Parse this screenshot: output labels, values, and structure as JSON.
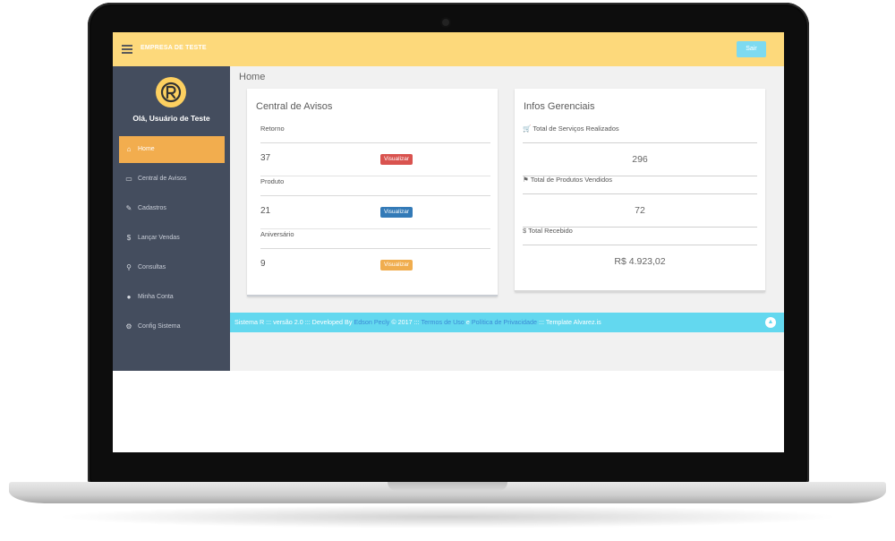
{
  "topbar": {
    "company_name": "EMPRESA DE TESTE",
    "logout_label": "Sair"
  },
  "sidebar": {
    "greeting": "Olá, Usuário de Teste",
    "items": [
      {
        "label": "Home",
        "icon": "home-icon"
      },
      {
        "label": "Central de Avisos",
        "icon": "monitor-icon"
      },
      {
        "label": "Cadastros",
        "icon": "edit-icon"
      },
      {
        "label": "Lançar Vendas",
        "icon": "dollar-icon"
      },
      {
        "label": "Consultas",
        "icon": "search-icon"
      },
      {
        "label": "Minha Conta",
        "icon": "user-icon"
      },
      {
        "label": "Config Sistema",
        "icon": "gears-icon"
      }
    ]
  },
  "main": {
    "page_title": "Home",
    "notices": {
      "title": "Central de Avisos",
      "rows": [
        {
          "label": "Retorno",
          "value": "37",
          "button": "Visualizar",
          "color": "#d9534f"
        },
        {
          "label": "Produto",
          "value": "21",
          "button": "Visualizar",
          "color": "#337ab7"
        },
        {
          "label": "Aniversário",
          "value": "9",
          "button": "Visualizar",
          "color": "#f0ad4e"
        }
      ]
    },
    "stats": {
      "title": "Infos Gerenciais",
      "rows": [
        {
          "label": "Total de Serviços Realizados",
          "value": "296",
          "icon": "cart-icon"
        },
        {
          "label": "Total de Produtos Vendidos",
          "value": "72",
          "icon": "tag-icon"
        },
        {
          "label": "Total Recebido",
          "value": "R$ 4.923,02",
          "icon": "dollar-icon"
        }
      ]
    }
  },
  "footer": {
    "part1": "Sistema R ::: versão 2.0 ::: Developed By ",
    "author": "Edson Pecly",
    "part2": " © 2017 ::: ",
    "terms": "Termos de Uso",
    "and": " e ",
    "privacy": "Política de Privacidade",
    "part3": " ::: Template Alvarez.is"
  },
  "colors": {
    "topbar": "#fdd97b",
    "sidebar": "#444d5e",
    "active_item": "#f2ad4e",
    "footer": "#63d8ef"
  }
}
